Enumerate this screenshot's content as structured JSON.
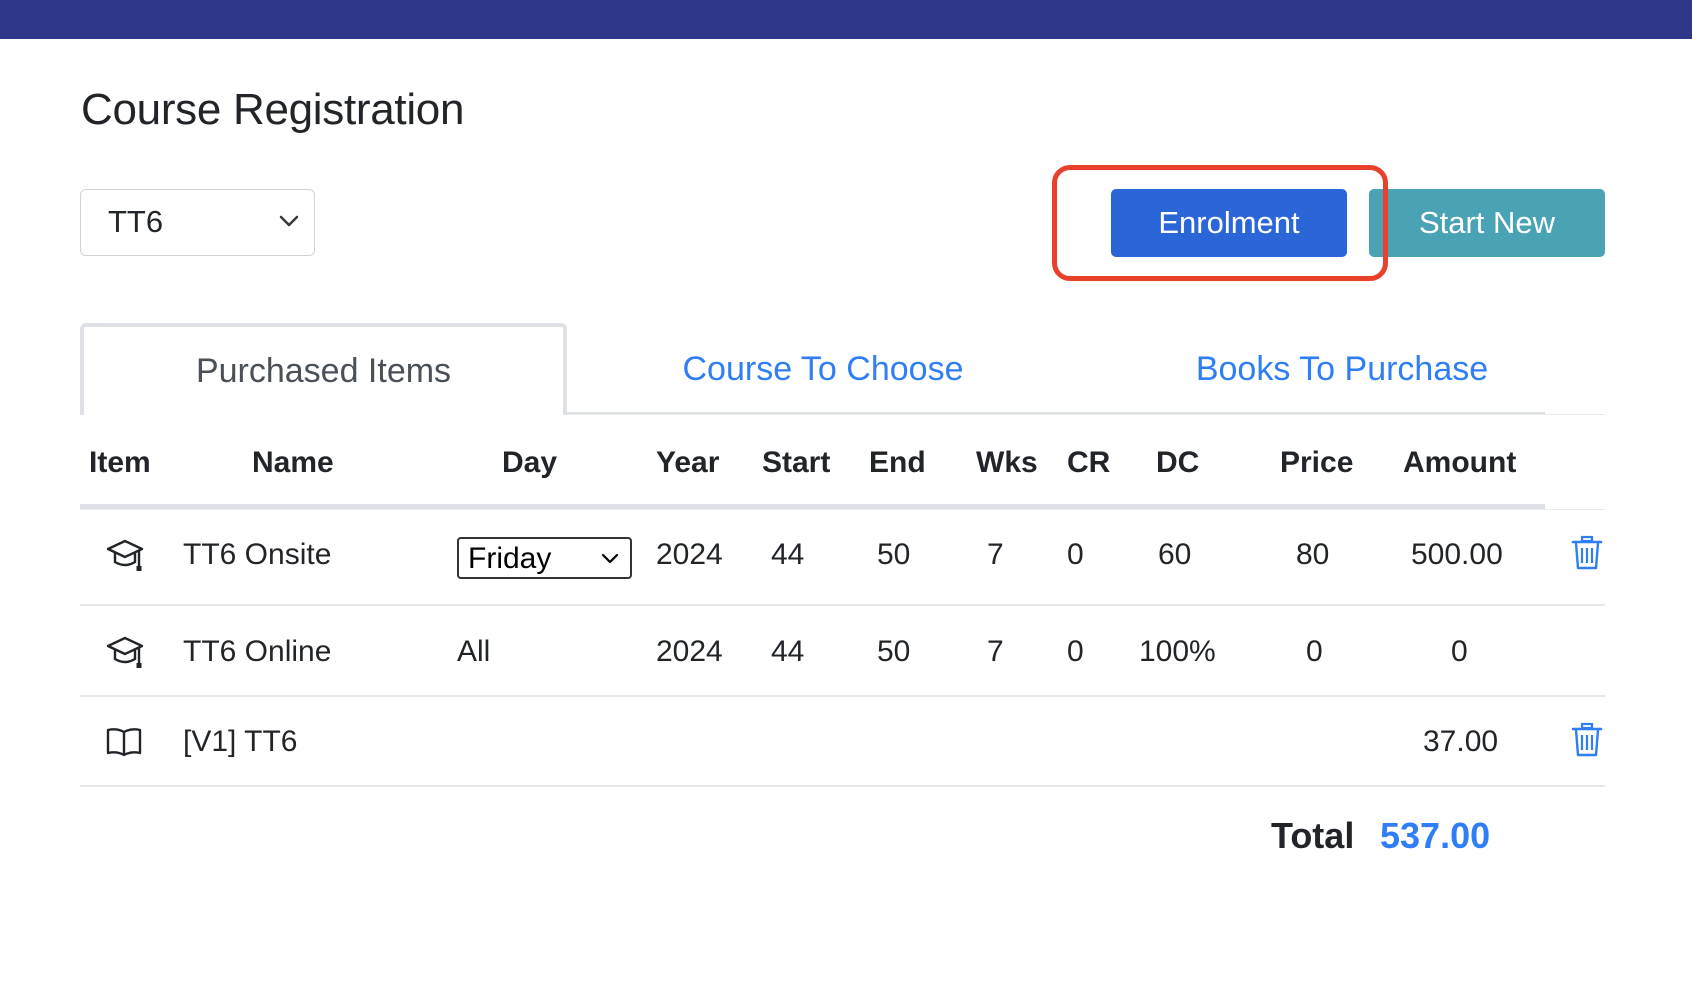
{
  "page": {
    "title": "Course Registration"
  },
  "controls": {
    "course_select_value": "TT6",
    "enrolment_label": "Enrolment",
    "start_new_label": "Start New"
  },
  "tabs": [
    {
      "label": "Purchased Items",
      "active": true
    },
    {
      "label": "Course To Choose",
      "active": false
    },
    {
      "label": "Books To Purchase",
      "active": false
    }
  ],
  "table": {
    "headers": {
      "item": "Item",
      "name": "Name",
      "day": "Day",
      "year": "Year",
      "start": "Start",
      "end": "End",
      "wks": "Wks",
      "cr": "CR",
      "dc": "DC",
      "price": "Price",
      "amount": "Amount"
    },
    "rows": [
      {
        "icon": "graduation-cap-icon",
        "name": "TT6 Onsite",
        "day": "Friday",
        "year": "2024",
        "start": "44",
        "end": "50",
        "wks": "7",
        "cr": "0",
        "dc": "60",
        "price": "80",
        "amount": "500.00"
      },
      {
        "icon": "graduation-cap-icon",
        "name": "TT6 Online",
        "day": "All",
        "year": "2024",
        "start": "44",
        "end": "50",
        "wks": "7",
        "cr": "0",
        "dc": "100%",
        "price": "0",
        "amount": "0"
      },
      {
        "icon": "book-icon",
        "name": "[V1] TT6",
        "amount": "37.00"
      }
    ]
  },
  "total": {
    "label": "Total",
    "value": "537.00"
  },
  "colors": {
    "topbar": "#2e3788",
    "primary_button": "#2b66d9",
    "info_button": "#4aa3b5",
    "link": "#2f7ef5",
    "highlight": "#e8402a"
  }
}
